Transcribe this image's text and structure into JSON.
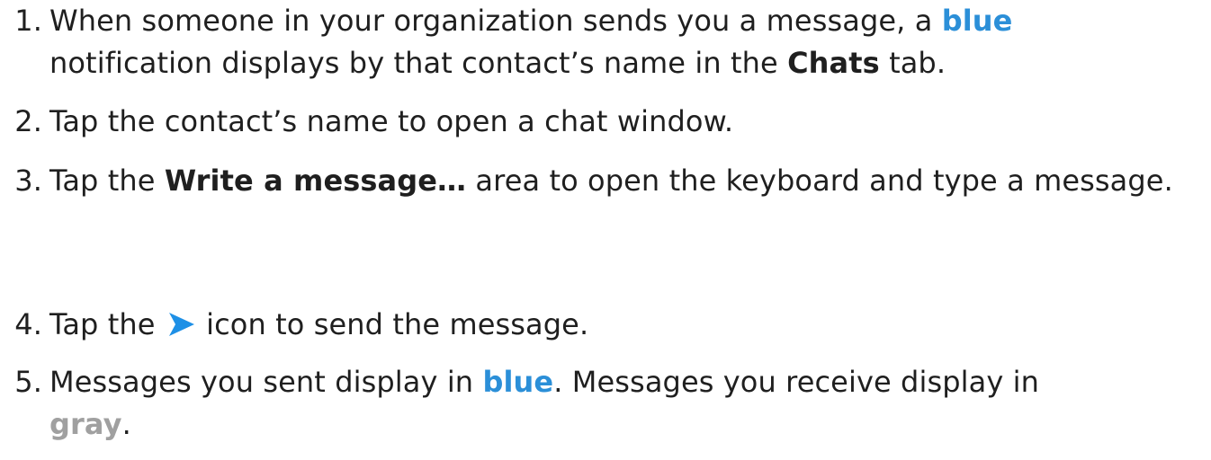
{
  "colors": {
    "text": "#1f1f1f",
    "blue": "#2b8fd8",
    "gray": "#a0a0a0",
    "send_icon": "#1e90e6"
  },
  "steps": [
    {
      "num": "1.",
      "parts": [
        "When someone in your organization sends you a message, a ",
        "blue",
        " notification displays by that contact’s name in the ",
        "Chats",
        " tab."
      ]
    },
    {
      "num": "2.",
      "parts": [
        "Tap the contact’s name to open a chat window."
      ]
    },
    {
      "num": "3.",
      "parts": [
        "Tap the ",
        "Write a message…",
        " area to open the keyboard and type a message."
      ]
    },
    {
      "num": "4.",
      "icon": "send-arrow-icon",
      "parts": [
        "Tap the ",
        " icon to send the message."
      ]
    },
    {
      "num": "5.",
      "parts": [
        "Messages you sent display in ",
        "blue",
        ". Messages you receive display in ",
        "gray",
        "."
      ]
    }
  ]
}
